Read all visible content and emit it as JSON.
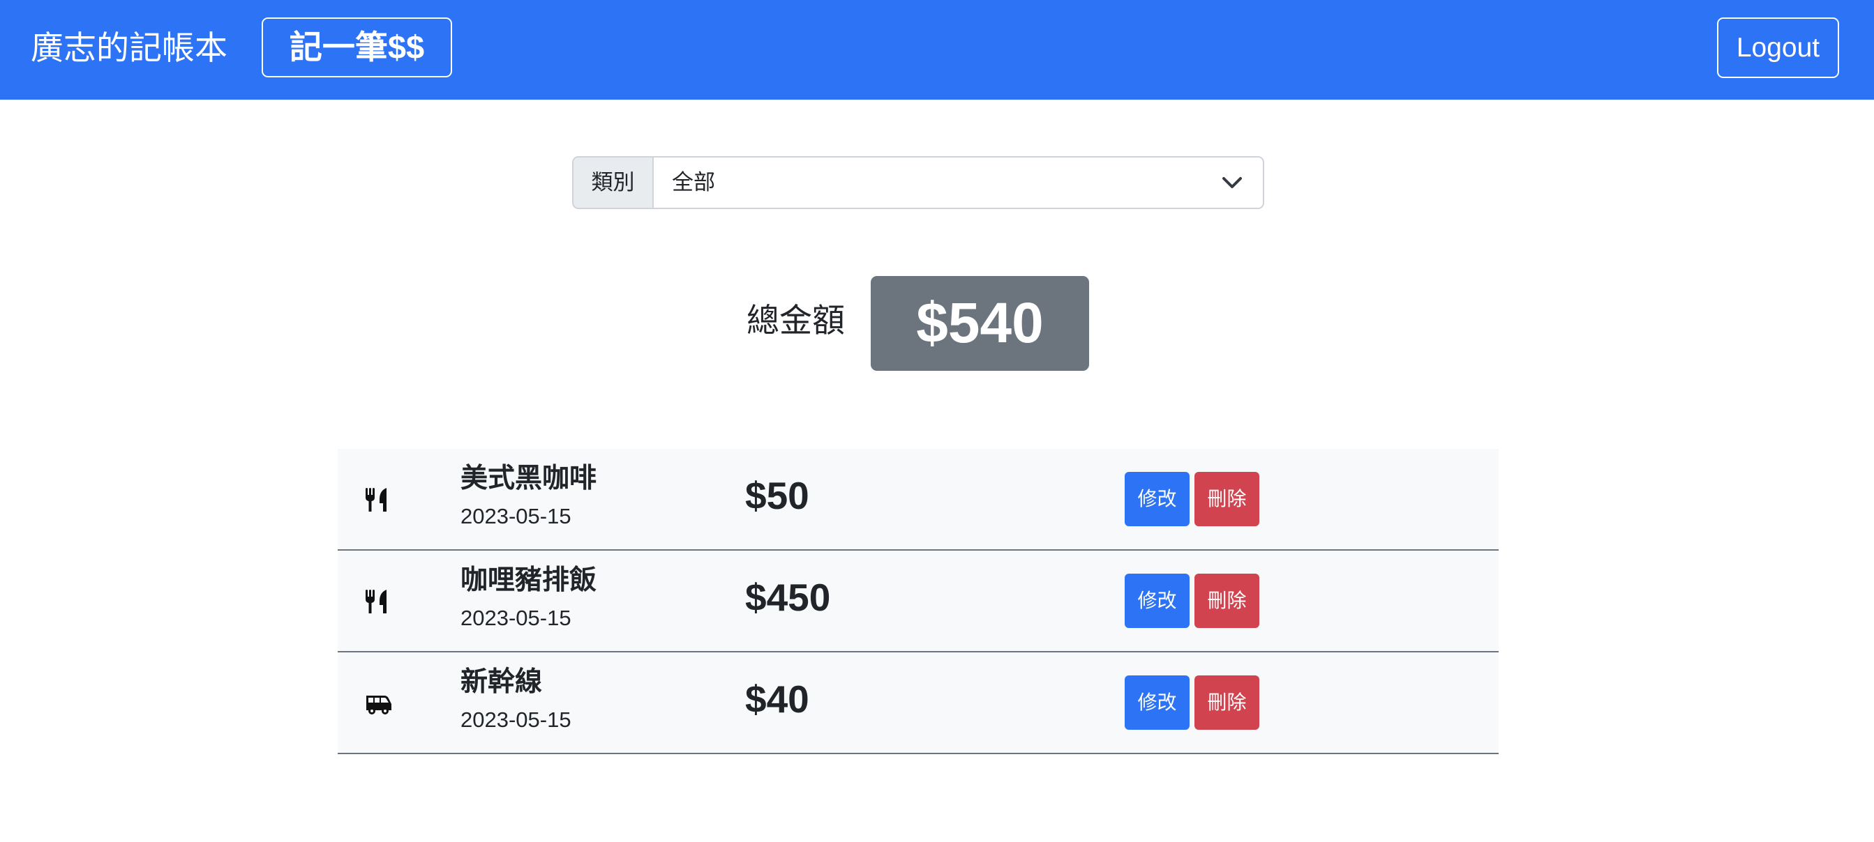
{
  "navbar": {
    "brand": "廣志的記帳本",
    "add_label": "記一筆$$",
    "logout_label": "Logout",
    "background_color": "#2d73f5"
  },
  "filter": {
    "label": "類別",
    "selected": "全部",
    "icon": "chevron-down-icon"
  },
  "total": {
    "label": "總金額",
    "amount": "$540"
  },
  "records": [
    {
      "icon": "utensils-icon",
      "name": "美式黑咖啡",
      "date": "2023-05-15",
      "amount": "$50",
      "edit_label": "修改",
      "delete_label": "刪除"
    },
    {
      "icon": "utensils-icon",
      "name": "咖哩豬排飯",
      "date": "2023-05-15",
      "amount": "$450",
      "edit_label": "修改",
      "delete_label": "刪除"
    },
    {
      "icon": "shuttle-van-icon",
      "name": "新幹線",
      "date": "2023-05-15",
      "amount": "$40",
      "edit_label": "修改",
      "delete_label": "刪除"
    }
  ],
  "colors": {
    "primary": "#2d73f5",
    "danger": "#d1434e",
    "secondary": "#6c757d",
    "row_background": "#f8f9fa"
  }
}
